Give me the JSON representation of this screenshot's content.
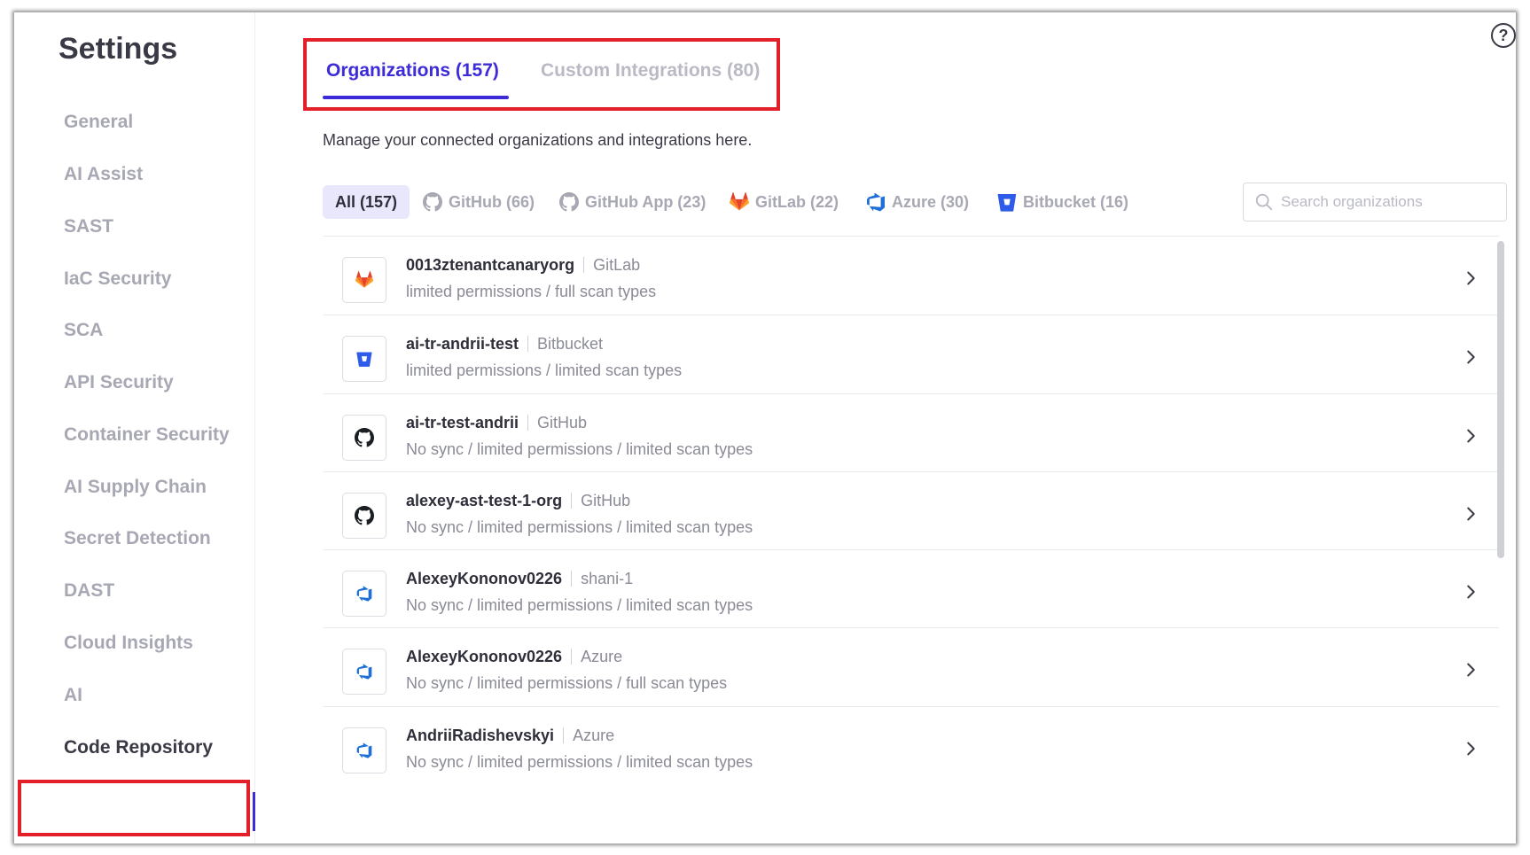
{
  "sidebar": {
    "title": "Settings",
    "items": [
      {
        "label": "General"
      },
      {
        "label": "AI Assist"
      },
      {
        "label": "SAST"
      },
      {
        "label": "IaC Security"
      },
      {
        "label": "SCA"
      },
      {
        "label": "API Security"
      },
      {
        "label": "Container Security"
      },
      {
        "label": "AI Supply Chain"
      },
      {
        "label": "Secret Detection"
      },
      {
        "label": "DAST"
      },
      {
        "label": "Cloud Insights"
      },
      {
        "label": "AI"
      },
      {
        "label": "Code Repository",
        "active": true
      }
    ]
  },
  "main": {
    "help_icon_label": "?",
    "tabs": [
      {
        "label": "Organizations (157)",
        "active": true
      },
      {
        "label": "Custom Integrations (80)"
      }
    ],
    "description": "Manage your connected organizations and integrations here.",
    "filters": [
      {
        "label": "All (157)",
        "active": true
      },
      {
        "label": "GitHub (66)",
        "icon": "github-icon"
      },
      {
        "label": "GitHub App (23)",
        "icon": "github-icon"
      },
      {
        "label": "GitLab (22)",
        "icon": "gitlab-icon"
      },
      {
        "label": "Azure (30)",
        "icon": "azure-icon"
      },
      {
        "label": "Bitbucket (16)",
        "icon": "bitbucket-icon"
      }
    ],
    "search": {
      "placeholder": "Search organizations",
      "value": ""
    },
    "organizations": [
      {
        "name": "0013ztenantcanaryorg",
        "provider": "GitLab",
        "meta": "limited permissions / full scan types",
        "icon": "gitlab-icon"
      },
      {
        "name": "ai-tr-andrii-test",
        "provider": "Bitbucket",
        "meta": "limited permissions / limited scan types",
        "icon": "bitbucket-icon"
      },
      {
        "name": "ai-tr-test-andrii",
        "provider": "GitHub",
        "meta": "No sync / limited permissions / limited scan types",
        "icon": "github-icon"
      },
      {
        "name": "alexey-ast-test-1-org",
        "provider": "GitHub",
        "meta": "No sync / limited permissions / limited scan types",
        "icon": "github-icon"
      },
      {
        "name": "AlexeyKononov0226",
        "provider": "shani-1",
        "meta": "No sync / limited permissions / limited scan types",
        "icon": "azure-icon"
      },
      {
        "name": "AlexeyKononov0226",
        "provider": "Azure",
        "meta": "No sync / limited permissions / full scan types",
        "icon": "azure-icon"
      },
      {
        "name": "AndriiRadishevskyi",
        "provider": "Azure",
        "meta": "No sync / limited permissions / limited scan types",
        "icon": "azure-icon"
      }
    ]
  },
  "colors": {
    "accent": "#3e2bd8",
    "highlight_box": "#e3202a",
    "gitlab": "#e24329",
    "azure": "#1f6fd8",
    "bitbucket": "#2f5bea"
  }
}
